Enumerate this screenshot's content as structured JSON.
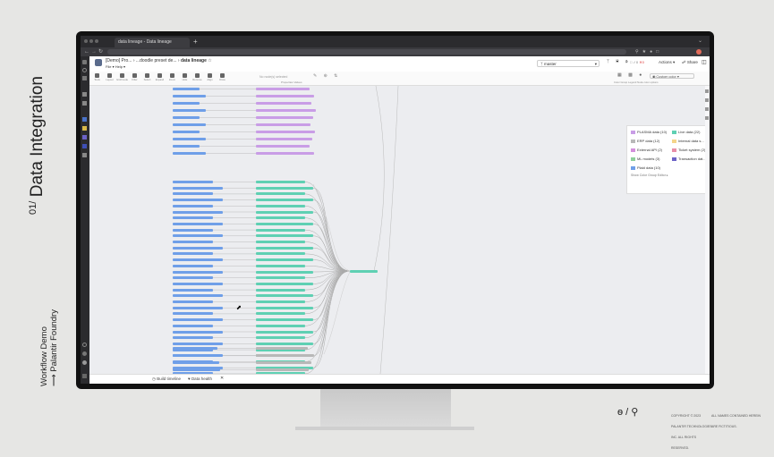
{
  "slide": {
    "number": "01/",
    "title": "Data Integration",
    "footer_line1": "Workflow Demo",
    "footer_line2": "⟶ Palantir Foundry",
    "copyright_lines": [
      "COPYRIGHT © 2023",
      "PALANTIR TECHNOLOGIES",
      "INC. ALL RIGHTS",
      "RESERVED."
    ],
    "rights_lines": [
      "ALL NAMES CONTAINED HEREIN",
      "ARE FICTITIOUS."
    ]
  },
  "browser": {
    "tab_title": "data lineage - Data lineage",
    "new_tab": "+"
  },
  "app": {
    "breadcrumb_1": "[Demo] Pro...",
    "breadcrumb_2": "...doodle preset de...",
    "breadcrumb_3": "data lineage",
    "file_menu": "File",
    "help_menu": "Help",
    "branch": "master",
    "actions_label": "Actions",
    "share_label": "Share"
  },
  "toolbar": {
    "items": [
      "Tools",
      "Layout",
      "Grid/mode",
      "Filter",
      "Select",
      "Expand",
      "Zoom",
      "Hide",
      "Remove",
      "Align",
      "Draw"
    ],
    "search_placeholder": "No node(s) selected",
    "preview_label": "Properties Values",
    "color_select": "Custom color",
    "right_labels": [
      "Color",
      "Group",
      "Legend",
      "Node color options"
    ]
  },
  "legend": {
    "items": [
      {
        "label": "PLASMA data (10)",
        "color": "#c99de6"
      },
      {
        "label": "Live data (22)",
        "color": "#5fd0b3"
      },
      {
        "label": "ERP data (12)",
        "color": "#b8b8b8"
      },
      {
        "label": "Internal data s... (15)",
        "color": "#f5d58a"
      },
      {
        "label": "External API (2)",
        "color": "#d48fdc"
      },
      {
        "label": "Ticket system (2)",
        "color": "#e88fa8"
      },
      {
        "label": "ML models (3)",
        "color": "#8fcf9b"
      },
      {
        "label": "Transaction dat... (13)",
        "color": "#6c63c7"
      },
      {
        "label": "Plaid data (10)",
        "color": "#6f9fe8"
      }
    ],
    "footer": "Show Color Group Editor ▸"
  },
  "status": {
    "items": [
      "Build timeline",
      "Data health"
    ]
  },
  "colors": {
    "blue_node": "#6f9fe8",
    "purple_node": "#c99de6",
    "green_node": "#5fd0b3",
    "grey_node": "#b8b8b8"
  }
}
